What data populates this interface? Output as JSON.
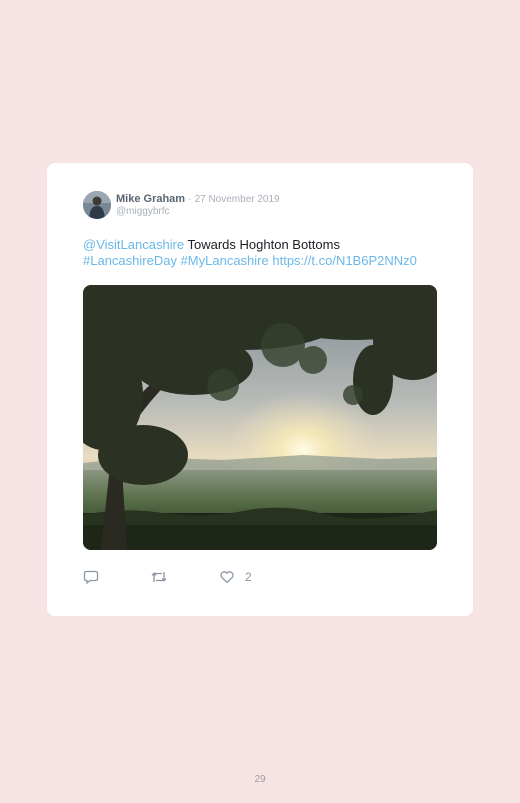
{
  "tweet": {
    "author_name": "Mike Graham",
    "separator": "·",
    "date": "27 November 2019",
    "handle": "@miggybrfc",
    "mention": "@VisitLancashire",
    "text": " Towards Hoghton Bottoms",
    "hashtag1": "#LancashireDay",
    "hashtag2": "#MyLancashire",
    "url": "https://t.co/N1B6P2NNz0",
    "like_count": "2"
  },
  "icons": {
    "reply": "reply-icon",
    "retweet": "retweet-icon",
    "like": "heart-icon"
  },
  "colors": {
    "page_background": "#f6e3e4",
    "card_background": "#ffffff",
    "link": "#6ab7e8"
  },
  "page": {
    "number": "29"
  }
}
